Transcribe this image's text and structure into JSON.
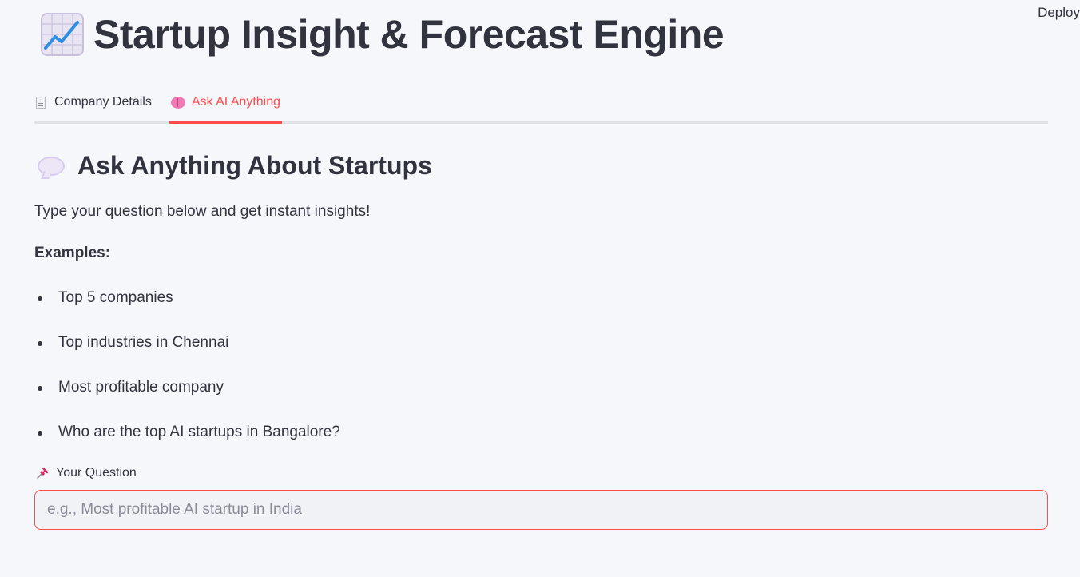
{
  "header": {
    "deploy_label": "Deploy",
    "title": "Startup Insight & Forecast Engine",
    "title_icon": "chart-increasing-icon"
  },
  "tabs": [
    {
      "label": "Company Details",
      "icon": "document-icon",
      "active": false
    },
    {
      "label": "Ask AI Anything",
      "icon": "brain-icon",
      "active": true
    }
  ],
  "ask": {
    "heading": "Ask Anything About Startups",
    "heading_icon": "speech-balloon-icon",
    "intro": "Type your question below and get instant insights!",
    "examples_label": "Examples:",
    "examples": [
      "Top 5 companies",
      "Top industries in Chennai",
      "Most profitable company",
      "Who are the top AI startups in Bangalore?"
    ],
    "question_label": "Your Question",
    "question_icon": "pushpin-icon",
    "question_value": "",
    "question_placeholder": "e.g., Most profitable AI startup in India"
  },
  "colors": {
    "accent": "#ff4b4b",
    "text": "#31333f",
    "background": "#f6f7fb",
    "input_bg": "#f0f2f6"
  }
}
